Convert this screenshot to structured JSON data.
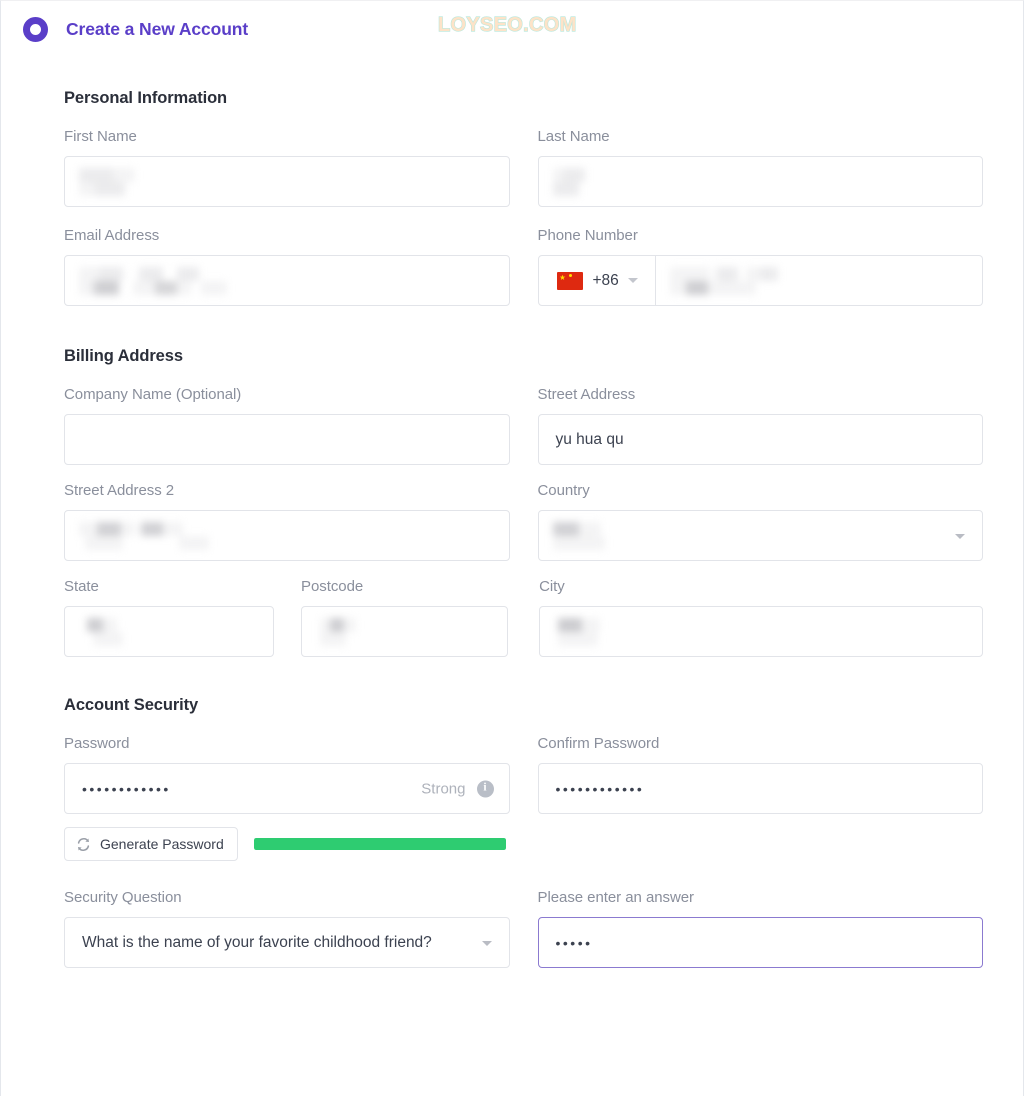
{
  "header": {
    "logo_icon": "ring-logo-icon",
    "title": "Create a New Account",
    "watermark": "LOYSEO.COM",
    "accent_color": "#5a3ec8"
  },
  "sections": {
    "personal": {
      "title": "Personal Information"
    },
    "billing": {
      "title": "Billing Address"
    },
    "security": {
      "title": "Account Security"
    }
  },
  "fields": {
    "first_name": {
      "label": "First Name",
      "value": "",
      "redacted": true
    },
    "last_name": {
      "label": "Last Name",
      "value": "",
      "redacted": true
    },
    "email": {
      "label": "Email Address",
      "value": "",
      "redacted": true
    },
    "phone": {
      "label": "Phone Number",
      "country_flag": "flag-cn-icon",
      "country_code": "+86",
      "value": "",
      "redacted": true
    },
    "company": {
      "label": "Company Name (Optional)",
      "value": ""
    },
    "street_address": {
      "label": "Street Address",
      "value": "yu hua qu"
    },
    "street_address_2": {
      "label": "Street Address 2",
      "value": "",
      "redacted": true
    },
    "country": {
      "label": "Country",
      "value": "",
      "redacted": true
    },
    "state": {
      "label": "State",
      "value": "",
      "redacted": true
    },
    "postcode": {
      "label": "Postcode",
      "value": "",
      "redacted": true
    },
    "city": {
      "label": "City",
      "value": "",
      "redacted": true
    },
    "password": {
      "label": "Password",
      "value": "••••••••••••",
      "strength_label": "Strong",
      "strength_percent": 100,
      "strength_color": "#2ecc71",
      "info_icon": "info-circle-icon"
    },
    "confirm_password": {
      "label": "Confirm Password",
      "value": "••••••••••••"
    },
    "security_question": {
      "label": "Security Question",
      "value": "What is the name of your favorite childhood friend?",
      "caret_icon": "chevron-down-icon"
    },
    "security_answer": {
      "label": "Please enter an answer",
      "value": "•••••",
      "focused": true,
      "focus_color": "#8b7ad0"
    }
  },
  "buttons": {
    "generate_password": {
      "label": "Generate Password",
      "icon": "refresh-icon"
    }
  }
}
